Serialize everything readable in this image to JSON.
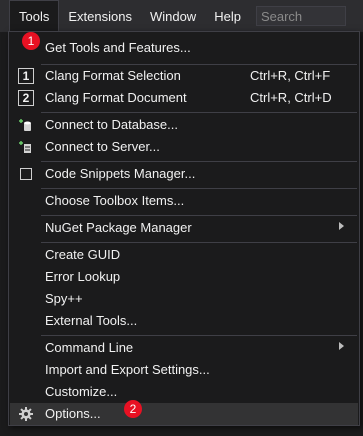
{
  "menubar": {
    "items": [
      "Tools",
      "Extensions",
      "Window",
      "Help"
    ],
    "search_placeholder": "Search"
  },
  "menu": {
    "get_tools": "Get Tools and Features...",
    "clang_selection": {
      "label": "Clang Format Selection",
      "shortcut": "Ctrl+R, Ctrl+F",
      "num": "1"
    },
    "clang_document": {
      "label": "Clang Format Document",
      "shortcut": "Ctrl+R, Ctrl+D",
      "num": "2"
    },
    "connect_db": "Connect to Database...",
    "connect_server": "Connect to Server...",
    "code_snippets": "Code Snippets Manager...",
    "toolbox_items": "Choose Toolbox Items...",
    "nuget": "NuGet Package Manager",
    "create_guid": "Create GUID",
    "error_lookup": "Error Lookup",
    "spy": "Spy++",
    "external_tools": "External Tools...",
    "command_line": "Command Line",
    "import_export": "Import and Export Settings...",
    "customize": "Customize...",
    "options": "Options..."
  },
  "annotations": {
    "badge1": "1",
    "badge2": "2"
  },
  "colors": {
    "menu_bg": "#1b1b1c",
    "menubar_bg": "#2d2d30",
    "badge": "#e81123",
    "highlight": "#333334"
  }
}
